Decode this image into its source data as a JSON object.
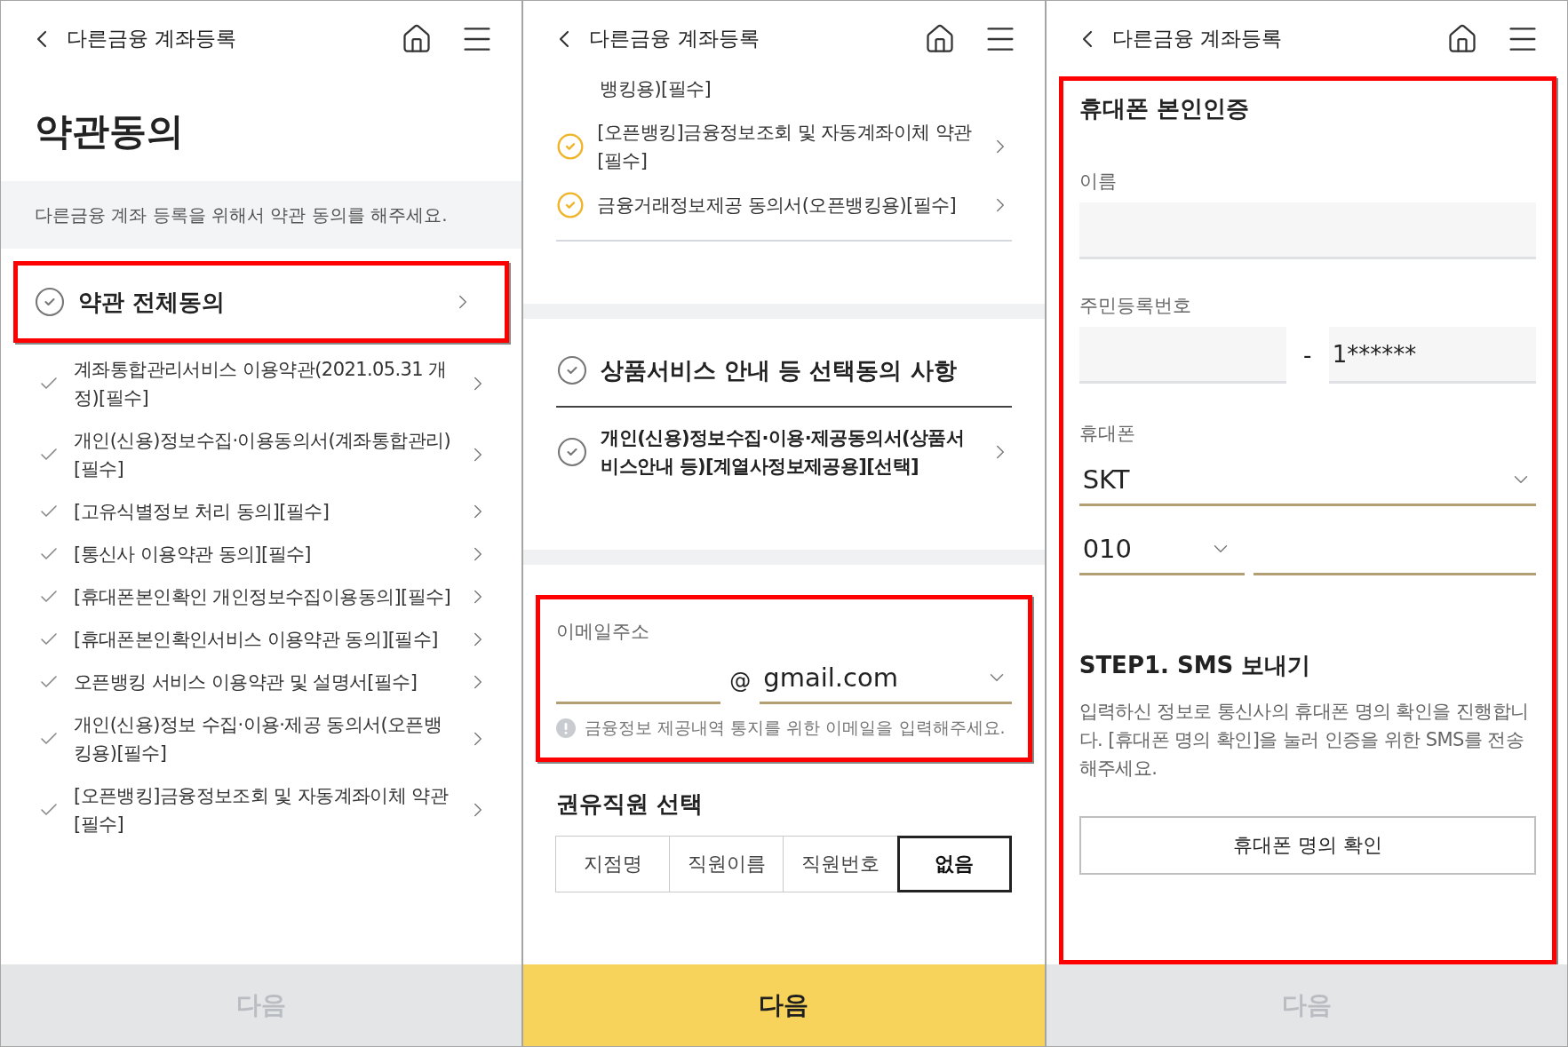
{
  "screens": [
    {
      "header": {
        "title": "다른금융 계좌등록"
      },
      "sections": [
        {
          "kind": "page_title",
          "text": "약관동의"
        },
        {
          "kind": "notice",
          "text": "다른금융 계좌 등록을 위해서 약관 동의를 해주세요."
        },
        {
          "kind": "agree_all",
          "label": "약관 전체동의",
          "checked": false,
          "highlighted": true
        },
        {
          "kind": "check_list",
          "items": [
            {
              "label": "계좌통합관리서비스 이용약관(2021.05.31 개정)[필수]",
              "checked": false
            },
            {
              "label": "개인(신용)정보수집·이용동의서(계좌통합관리)[필수]",
              "checked": false
            },
            {
              "label": "[고유식별정보 처리 동의][필수]",
              "checked": false
            },
            {
              "label": "[통신사 이용약관 동의][필수]",
              "checked": false
            },
            {
              "label": "[휴대폰본인확인 개인정보수집이용동의][필수]",
              "checked": false
            },
            {
              "label": "[휴대폰본인확인서비스 이용약관 동의][필수]",
              "checked": false
            },
            {
              "label": "오픈뱅킹 서비스 이용약관 및 설명서[필수]",
              "checked": false
            },
            {
              "label": "개인(신용)정보 수집·이용·제공 동의서(오픈뱅킹용)[필수]",
              "checked": false
            },
            {
              "label": "[오픈뱅킹]금융정보조회 및 자동계좌이체 약관[필수]",
              "checked": false
            }
          ]
        }
      ],
      "next_button": {
        "label": "다음",
        "disabled": true
      }
    },
    {
      "header": {
        "title": "다른금융 계좌등록"
      },
      "sections": [
        {
          "kind": "fragment",
          "text": "뱅킹용)[필수]"
        },
        {
          "kind": "circle_list",
          "items": [
            {
              "label": "[오픈뱅킹]금융정보조회 및 자동계좌이체 약관[필수]",
              "checked": true
            },
            {
              "label": "금융거래정보제공 동의서(오픈뱅킹용)[필수]",
              "checked": true
            }
          ]
        },
        {
          "kind": "consent_group",
          "heading": {
            "label": "상품서비스 안내 등 선택동의 사항",
            "checked": false
          },
          "items": [
            {
              "label": "개인(신용)정보수집·이용·제공동의서(상품서비스안내 등)[계열사정보제공용][선택]",
              "checked": false
            }
          ]
        },
        {
          "kind": "email",
          "highlighted": true,
          "label": "이메일주소",
          "at": "@",
          "domain": "gmail.com",
          "hint": "금융정보 제공내역 통지를 위한 이메일을 입력해주세요."
        },
        {
          "kind": "segmented",
          "title": "권유직원 선택",
          "options": [
            {
              "label": "지점명",
              "selected": false
            },
            {
              "label": "직원이름",
              "selected": false
            },
            {
              "label": "직원번호",
              "selected": false
            },
            {
              "label": "없음",
              "selected": true
            }
          ]
        }
      ],
      "next_button": {
        "label": "다음",
        "disabled": false
      }
    },
    {
      "header": {
        "title": "다른금융 계좌등록"
      },
      "sections": [
        {
          "kind": "verification",
          "highlighted": true,
          "title": "휴대폰 본인인증",
          "name_label": "이름",
          "id_label": "주민등록번호",
          "id_separator": "-",
          "id_back": "1******",
          "phone_label": "휴대폰",
          "carrier": "SKT",
          "prefix": "010",
          "step_title": "STEP1. SMS 보내기",
          "step_text": "입력하신 정보로 통신사의 휴대폰 명의 확인을 진행합니다. [휴대폰 명의 확인]을 눌러 인증을 위한 SMS를 전송해주세요.",
          "button": "휴대폰 명의 확인"
        }
      ],
      "next_button": {
        "label": "다음",
        "disabled": true
      }
    }
  ]
}
